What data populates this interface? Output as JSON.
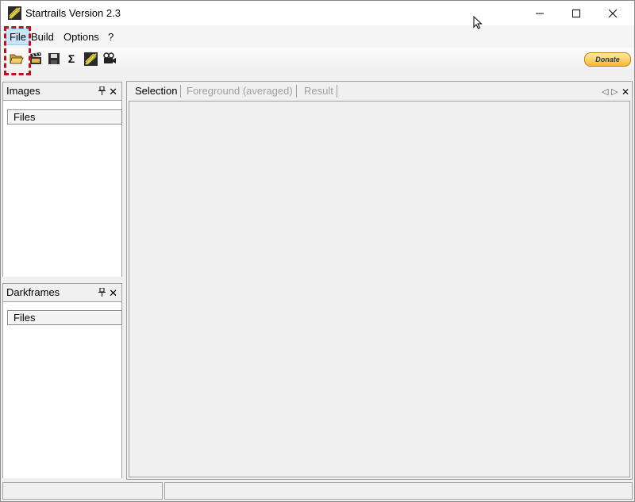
{
  "window": {
    "title": "Startrails Version 2.3",
    "controls": {
      "minimize": "–",
      "maximize": "☐",
      "close": "✕"
    }
  },
  "menu": {
    "items": [
      {
        "label": "File",
        "active": true
      },
      {
        "label": "Build"
      },
      {
        "label": "Options"
      },
      {
        "label": "?"
      }
    ]
  },
  "toolbar": {
    "buttons": [
      {
        "icon": "open-folder-icon"
      },
      {
        "icon": "clapper-icon"
      },
      {
        "icon": "save-icon"
      },
      {
        "icon": "sigma-icon",
        "glyph": "Σ"
      },
      {
        "icon": "startrails-icon"
      },
      {
        "icon": "video-camera-icon"
      }
    ],
    "donate_label": "Donate"
  },
  "panels": {
    "images": {
      "title": "Images",
      "column": "Files"
    },
    "darkframes": {
      "title": "Darkframes",
      "column": "Files"
    }
  },
  "main": {
    "tabs": [
      {
        "label": "Selection",
        "selected": true
      },
      {
        "label": "Foreground (averaged)",
        "selected": false
      },
      {
        "label": "Result",
        "selected": false
      }
    ]
  },
  "colors": {
    "menu_active_bg": "#cce4f7",
    "highlight_marker": "#c0101a",
    "donate_gradient": "#f7b733"
  }
}
